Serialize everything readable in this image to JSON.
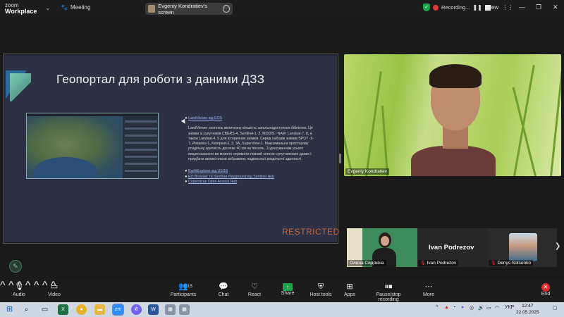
{
  "titlebar": {
    "logo_line1": "zoom",
    "logo_line2": "Workplace",
    "meeting_label": "Meeting",
    "share_label": "Evgeniy Kondratiev's screen",
    "recording_label": "Recording...",
    "view_label": "View",
    "recording_color": "#e03a3a",
    "shield_color": "#1aa34a"
  },
  "slide": {
    "title": "Геопортал для роботи з даними ДЗЗ",
    "link1": "LandViewer від EOS",
    "paragraph": "LandViewer охоплює величезну кількість загальнодоступних бібліотек. Це знімки із супутників CBERS-4, Sentinel-1, 2, MODIS / NAIP, Landsat-7, 8, а також Landsat-4, 5 для історичних знімків. Серед наборів знімків SPOT -5-7, Pleiades-1, Kompsat-2, 3, 3A, SuperView-1. Максимальна просторову роздільну здатність досягає 40 см на піксель. З урахуванням усього вищесказаного ви можете отримати повний список супутникових даних і придбати великі плани зображень надвисокої роздільної здатності.",
    "link2": "EarthExplorer від USGS",
    "link3": "EO Browser та Sentinel Playground від Sentinel Hub",
    "link4": "Copernicus Open Access Hub",
    "watermark": "RESTRICTED",
    "watermark_color": "#c9623a"
  },
  "videos": {
    "main_name": "Evgeniy Kondratiev",
    "olena_name": "Олена Сидякіна",
    "ivan_title": "Ivan Podrezov",
    "ivan_name": "Ivan Podrezov",
    "denys_name": "Denys Sotsenko"
  },
  "toolbar": {
    "audio": "Audio",
    "video": "Video",
    "participants": "Participants",
    "participants_count": "15",
    "chat": "Chat",
    "react": "React",
    "share": "Share",
    "host_tools": "Host tools",
    "apps": "Apps",
    "pause_stop": "Pause/stop recording",
    "more": "More",
    "end": "End"
  },
  "taskbar": {
    "lang": "УКР",
    "time": "12:47",
    "date": "22.05.2025"
  }
}
